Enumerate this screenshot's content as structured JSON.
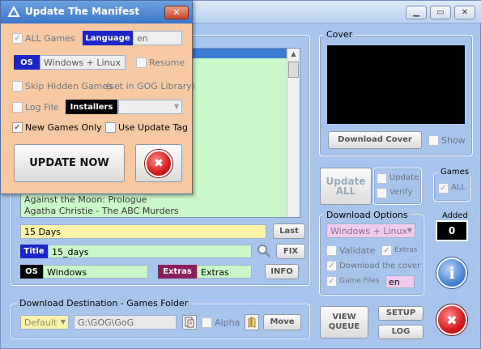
{
  "popup": {
    "title": "Update The Manifest",
    "all_games_label": "ALL Games",
    "language_tag": "Language",
    "language_value": "en",
    "os_tag": "OS",
    "os_value": "Windows + Linux",
    "resume_label": "Resume",
    "skip_hidden_label": "Skip Hidden Games",
    "skip_hidden_note": "(set in GOG Library)",
    "logfile_label": "Log File",
    "installers_tag": "Installers",
    "installers_value": "",
    "new_games_only_label": "New Games Only",
    "use_update_tag_label": "Use Update Tag",
    "update_now_label": "UPDATE NOW",
    "close_glyph": "✖"
  },
  "main": {
    "game_list": [
      "Against the Moon: Prologue",
      "Agatha Christie - The ABC Murders"
    ],
    "search_value": "15 Days",
    "last_button": "Last",
    "title_tag": "Title",
    "title_value": "15_days",
    "fix_button": "FIX",
    "os_tag": "OS",
    "os_value": "Windows",
    "extras_tag": "Extras",
    "extras_value": "Extras",
    "info_button": "INFO",
    "download_dest": {
      "label": "Download Destination - Games Folder",
      "preset": "Default",
      "path": "G:\\GOG\\GoG",
      "alpha_label": "Alpha",
      "move_button": "Move"
    },
    "cover": {
      "label": "Cover",
      "download_button": "Download Cover",
      "show_label": "Show"
    },
    "update_all_button": "Update ALL",
    "update_check_label": "Update",
    "verify_check_label": "Verify",
    "games_group": {
      "label": "Games",
      "all_label": "ALL"
    },
    "added_group": {
      "label": "Added",
      "value": "0"
    },
    "download_options": {
      "label": "Download Options",
      "os_select": "Windows + Linux",
      "validate_label": "Validate",
      "extras_label": "Extras",
      "download_cover_label": "Download the cover",
      "game_files_label": "Game Files",
      "game_files_lang": "en"
    },
    "view_queue_button": "VIEW QUEUE",
    "setup_button": "SETUP",
    "log_button": "LOG"
  },
  "colors": {
    "window_bg": "#a6c4ec",
    "popup_bg": "#f6c9a3",
    "list_bg": "#c9f7c8",
    "yellow_field": "#fbf4a8",
    "title_tag": "#1b25c9",
    "os_tag": "#000000",
    "extras_tag": "#8b1f5e",
    "language_tag": "#1b25c9"
  }
}
